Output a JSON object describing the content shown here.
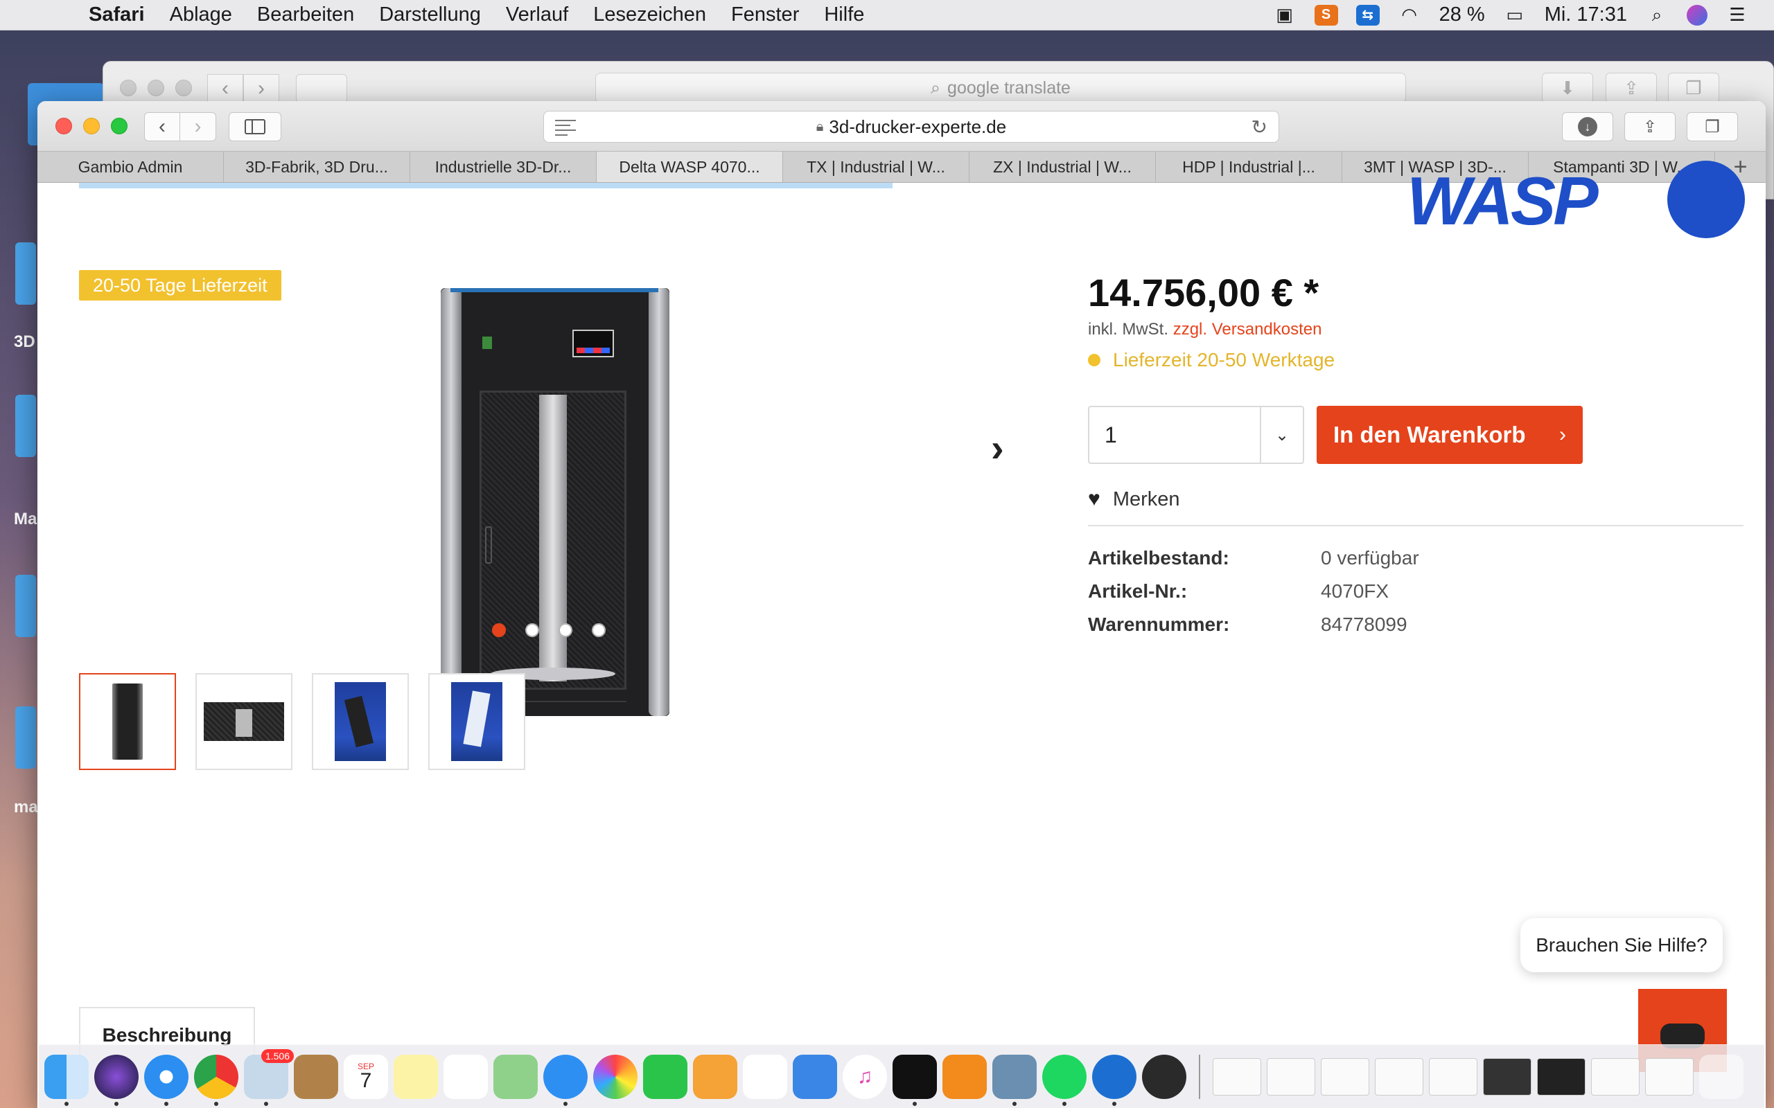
{
  "menubar": {
    "app_name": "Safari",
    "items": [
      "Ablage",
      "Bearbeiten",
      "Darstellung",
      "Verlauf",
      "Lesezeichen",
      "Fenster",
      "Hilfe"
    ],
    "battery": "28 %",
    "clock": "Mi. 17:31",
    "status_badge_s": "S"
  },
  "desktop": {
    "labels": [
      "3D",
      "Ma",
      "ma"
    ]
  },
  "back_window": {
    "address": "google translate"
  },
  "browser": {
    "url": "3d-drucker-experte.de",
    "tabs": [
      "Gambio Admin",
      "3D-Fabrik, 3D Dru...",
      "Industrielle 3D-Dr...",
      "Delta WASP 4070...",
      "TX | Industrial | W...",
      "ZX | Industrial | W...",
      "HDP | Industrial |...",
      "3MT | WASP | 3D-...",
      "Stampanti 3D | W..."
    ],
    "active_tab_index": 3
  },
  "product": {
    "logo_text": "WASP",
    "delivery_badge": "20-50 Tage Lieferzeit",
    "price": "14.756,00 € *",
    "tax_prefix": "inkl. MwSt.",
    "tax_link": "zzgl. Versandkosten",
    "delivery_text": "Lieferzeit 20-50 Werktage",
    "quantity": "1",
    "cart_button": "In den Warenkorb",
    "wishlist": "Merken",
    "specs": [
      {
        "label": "Artikelbestand:",
        "value": "0 verfügbar"
      },
      {
        "label": "Artikel-Nr.:",
        "value": "4070FX"
      },
      {
        "label": "Warennummer:",
        "value": "84778099"
      }
    ],
    "carousel_active": 1,
    "carousel_count": 4,
    "description_tab": "Beschreibung"
  },
  "help": {
    "bubble": "Brauchen Sie Hilfe?"
  },
  "dock": {
    "mail_badge": "1.506",
    "calendar_day": "7",
    "calendar_month": "SEP"
  },
  "colors": {
    "accent": "#e5431b",
    "delivery_yellow": "#f2c12e",
    "wasp_blue": "#1e4fc8"
  }
}
